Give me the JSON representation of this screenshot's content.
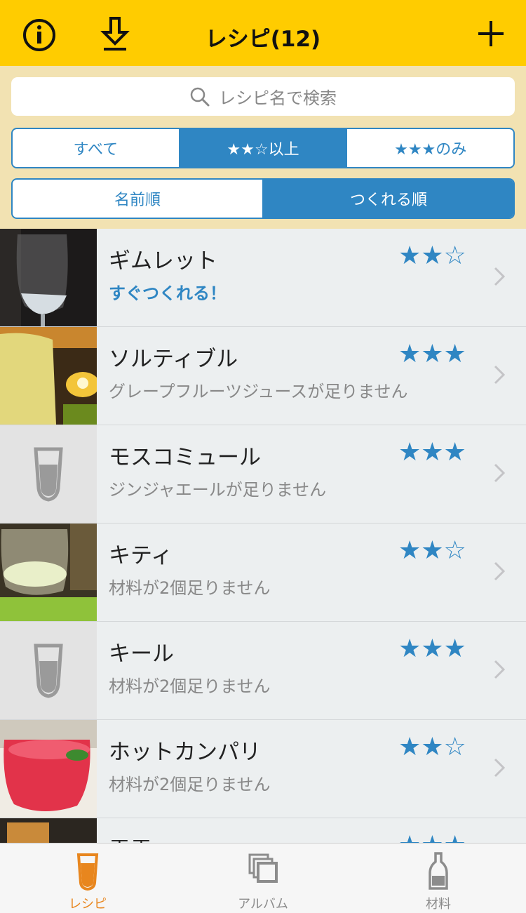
{
  "nav": {
    "title": "レシピ(12)",
    "info_icon": "info-icon",
    "download_icon": "download-icon",
    "add_icon": "plus-icon"
  },
  "search": {
    "placeholder": "レシピ名で検索"
  },
  "rating_filter": [
    {
      "label": "すべて",
      "selected": false
    },
    {
      "label": "★★☆以上",
      "selected": true
    },
    {
      "label": "★★★のみ",
      "selected": false
    }
  ],
  "sort_filter": [
    {
      "label": "名前順",
      "selected": false
    },
    {
      "label": "つくれる順",
      "selected": true
    }
  ],
  "recipes": [
    {
      "name": "ギムレット",
      "stars": "★★☆",
      "status": "すぐつくれる！",
      "makeable": true,
      "thumb": "photo"
    },
    {
      "name": "ソルティブル",
      "stars": "★★★",
      "status": "グレープフルーツジュースが足りません",
      "makeable": false,
      "thumb": "photo"
    },
    {
      "name": "モスコミュール",
      "stars": "★★★",
      "status": "ジンジャエールが足りません",
      "makeable": false,
      "thumb": "placeholder"
    },
    {
      "name": "キティ",
      "stars": "★★☆",
      "status": "材料が2個足りません",
      "makeable": false,
      "thumb": "photo"
    },
    {
      "name": "キール",
      "stars": "★★★",
      "status": "材料が2個足りません",
      "makeable": false,
      "thumb": "placeholder"
    },
    {
      "name": "ホットカンパリ",
      "stars": "★★☆",
      "status": "材料が2個足りません",
      "makeable": false,
      "thumb": "photo"
    },
    {
      "name": "雪雪",
      "stars": "★★★",
      "status": "",
      "makeable": false,
      "thumb": "photo"
    }
  ],
  "tabs": [
    {
      "label": "レシピ",
      "icon": "glass-icon",
      "active": true
    },
    {
      "label": "アルバム",
      "icon": "album-icon",
      "active": false
    },
    {
      "label": "材料",
      "icon": "bottle-icon",
      "active": false
    }
  ],
  "colors": {
    "nav": "#ffcc00",
    "filter_bg": "#f2e2b2",
    "accent": "#2f86c3",
    "tab_active": "#e8861e"
  }
}
